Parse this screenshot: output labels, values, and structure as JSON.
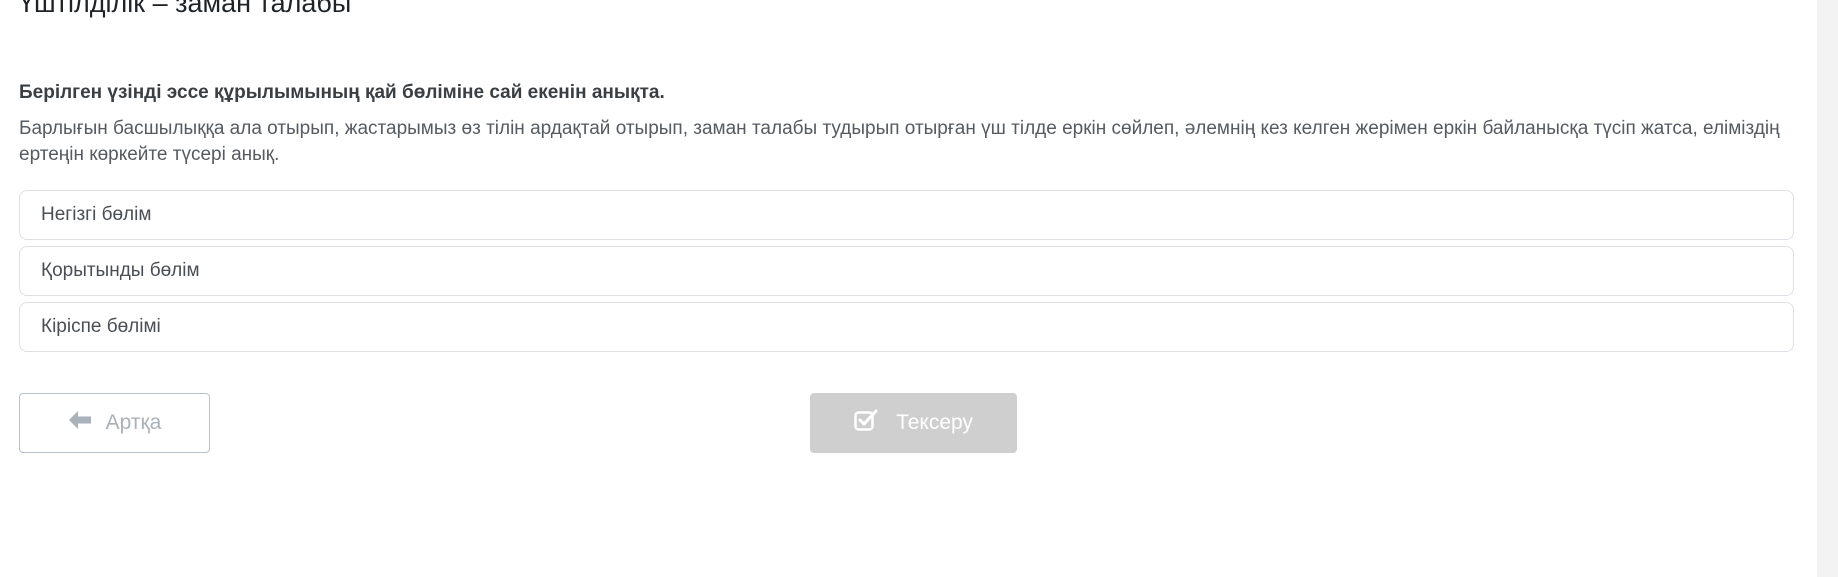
{
  "lesson": {
    "title": "Үштілділік – заман талабы"
  },
  "task": {
    "question": "Берілген үзінді эссе құрылымының қай бөліміне сай екенін анықта.",
    "passage": "Барлығын басшылыққа ала отырып, жастарымыз өз тілін ардақтай отырып, заман талабы тудырып отырған үш тілде еркін сөйлеп, әлемнің кез келген жерімен еркін байланысқа түсіп жатса, еліміздің ертеңін көркейте түсері анық."
  },
  "options": [
    {
      "label": "Негізгі бөлім"
    },
    {
      "label": "Қорытынды бөлім"
    },
    {
      "label": "Кіріспе бөлімі"
    }
  ],
  "actions": {
    "back_label": "Артқа",
    "back_icon": "arrow-left-icon",
    "check_label": "Тексеру",
    "check_icon": "checkbox-checked-icon"
  },
  "colors": {
    "check_button_disabled": "#cfcfcf",
    "back_button_border": "#b9c0c8",
    "option_border": "#dde1e5"
  }
}
